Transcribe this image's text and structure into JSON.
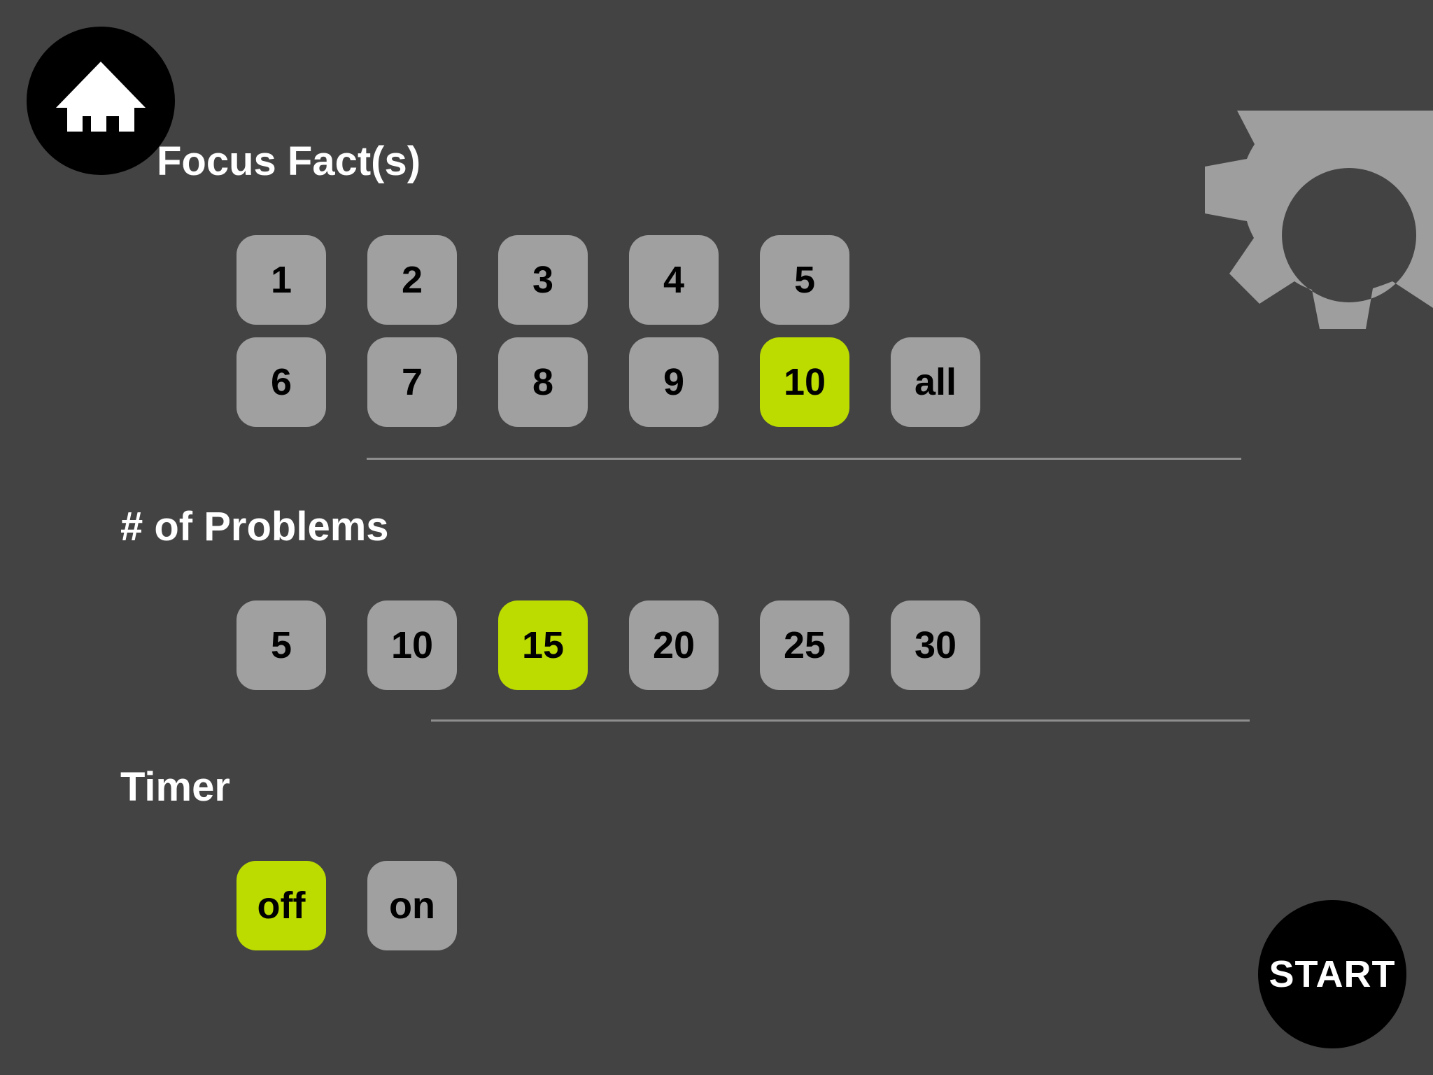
{
  "focus_facts": {
    "title": "Focus Fact(s)",
    "options": [
      "1",
      "2",
      "3",
      "4",
      "5",
      "6",
      "7",
      "8",
      "9",
      "10",
      "all"
    ],
    "selected": "10"
  },
  "problems": {
    "title": "# of Problems",
    "options": [
      "5",
      "10",
      "15",
      "20",
      "25",
      "30"
    ],
    "selected": "15"
  },
  "timer": {
    "title": "Timer",
    "options": [
      "off",
      "on"
    ],
    "selected": "off"
  },
  "start": {
    "label": "START"
  },
  "icons": {
    "home": "home-icon",
    "settings": "gear-icon"
  },
  "colors": {
    "background": "#434343",
    "button": "#a0a0a0",
    "selected": "#bcdc00",
    "circle_button": "#000000",
    "gear": "#9e9e9e"
  }
}
